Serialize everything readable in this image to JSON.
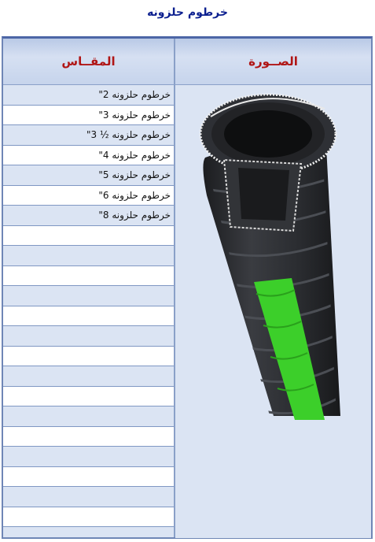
{
  "page_title": "خرطوم حلزونه",
  "table": {
    "headers": {
      "size": "المقــاس",
      "image": "الصــورة"
    },
    "rows": [
      "خرطوم حلزونه  2\"",
      "خرطوم حلزونه  3\"",
      "خرطوم حلزونه  ½ 3\"",
      "خرطوم حلزونه  4\"",
      "خرطوم حلزونه  5\"",
      "خرطوم حلزونه  6\"",
      "خرطوم حلزونه  8\"",
      "",
      "",
      "",
      "",
      "",
      "",
      "",
      "",
      "",
      "",
      "",
      "",
      "",
      "",
      ""
    ]
  },
  "image": {
    "icon": "spiral-hose-image",
    "stripe_color": "#3ccf2a",
    "hose_color": "#2b2d31"
  }
}
